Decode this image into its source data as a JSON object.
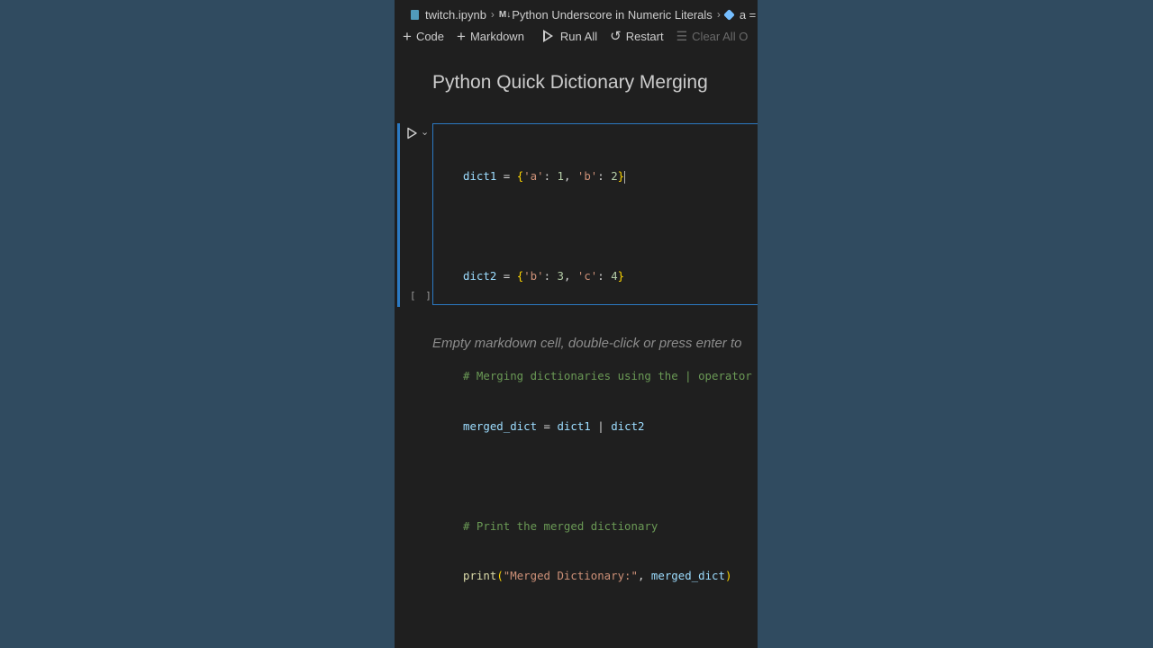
{
  "breadcrumb": {
    "file": "twitch.ipynb",
    "section_marker": "M↓",
    "section": "Python Underscore in Numeric Literals",
    "symbol": "a ="
  },
  "toolbar": {
    "code_label": "Code",
    "markdown_label": "Markdown",
    "run_all_label": "Run All",
    "restart_label": "Restart",
    "clear_label": "Clear All O"
  },
  "heading": "Python Quick Dictionary Merging",
  "cell": {
    "exec_count": "[ ]",
    "code_lines": [
      "dict1 = {'a': 1, 'b': 2}",
      "",
      "dict2 = {'b': 3, 'c': 4}",
      "",
      "# Merging dictionaries using the | operator",
      "merged_dict = dict1 | dict2",
      "",
      "# Print the merged dictionary",
      "print(\"Merged Dictionary:\", merged_dict)"
    ]
  },
  "markdown_placeholder": "Empty markdown cell, double-click or press enter to",
  "colors": {
    "background": "#304b60",
    "editor_bg": "#1f1f1f",
    "focus_border": "#2b79c2"
  }
}
